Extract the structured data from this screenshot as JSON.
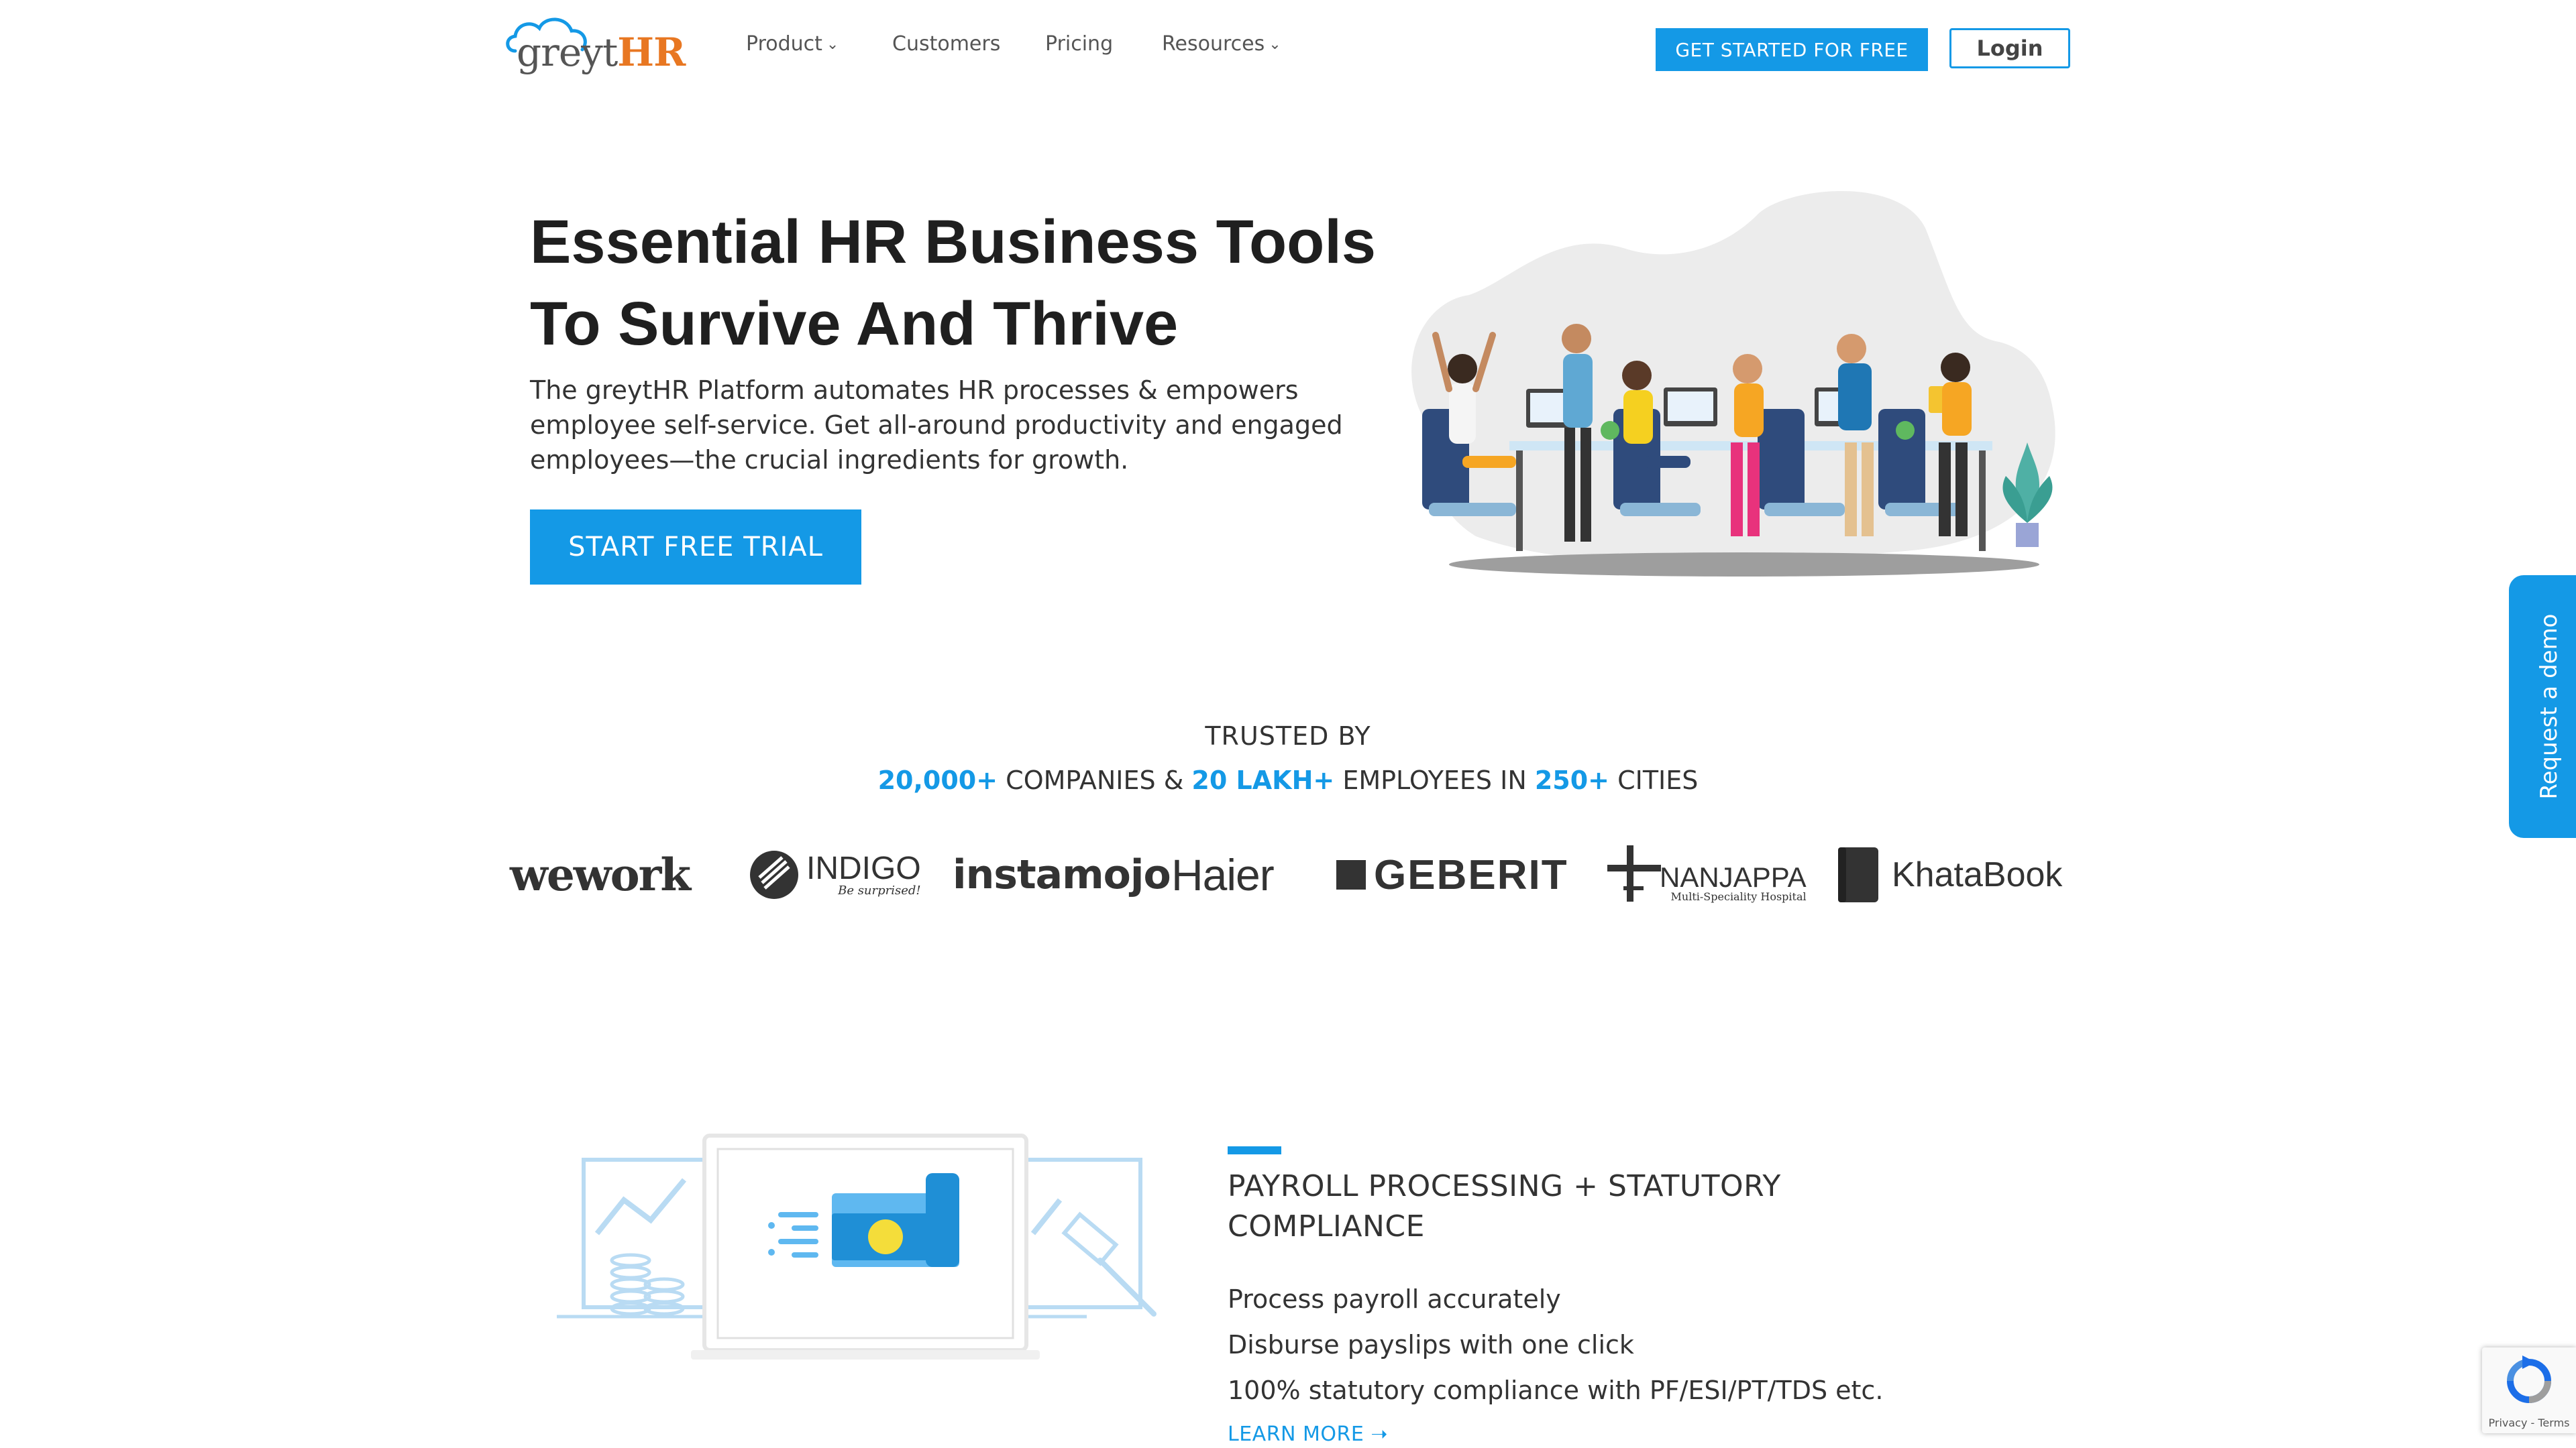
{
  "header": {
    "logo_text_a": "greyt",
    "logo_text_b": "HR",
    "nav": [
      {
        "label": "Product",
        "has_dropdown": true
      },
      {
        "label": "Customers",
        "has_dropdown": false
      },
      {
        "label": "Pricing",
        "has_dropdown": false
      },
      {
        "label": "Resources",
        "has_dropdown": true
      }
    ],
    "get_started_label": "GET STARTED FOR FREE",
    "login_label": "Login"
  },
  "hero": {
    "title_line1": "Essential HR Business Tools",
    "title_line2": "To Survive And Thrive",
    "description": "The greytHR Platform automates HR processes & empowers employee self-service. Get all-around productivity and engaged employees—the crucial ingredients for growth.",
    "cta_label": "START FREE TRIAL"
  },
  "side_tab": {
    "label": "Request a demo"
  },
  "trusted": {
    "heading": "TRUSTED BY",
    "companies_count": "20,000+",
    "companies_label": " COMPANIES & ",
    "employees_count": "20 LAKH+",
    "employees_label": " EMPLOYEES IN ",
    "cities_count": "250+",
    "cities_label": " CITIES"
  },
  "client_logos": [
    {
      "name": "wework",
      "text": "wework"
    },
    {
      "name": "indigo",
      "text": "INDIGO",
      "subtext": "Be surprised!"
    },
    {
      "name": "instamojo",
      "text": "instamojo"
    },
    {
      "name": "haier",
      "text": "Haier"
    },
    {
      "name": "geberit",
      "text": "GEBERIT"
    },
    {
      "name": "nanjappa",
      "text": "NANJAPPA",
      "subtext": "Multi-Speciality Hospital"
    },
    {
      "name": "khatabook",
      "text": "KhataBook"
    }
  ],
  "feature": {
    "title": "PAYROLL PROCESSING + STATUTORY COMPLIANCE",
    "items": [
      "Process payroll accurately",
      "Disburse payslips with one click",
      "100% statutory compliance with PF/ESI/PT/TDS etc."
    ],
    "learn_more_label": "LEARN MORE ➝"
  },
  "recaptcha": {
    "footer": "Privacy - Terms"
  },
  "colors": {
    "brand_blue": "#1499e6",
    "brand_orange": "#e87722",
    "text_dark": "#1f1f1f"
  }
}
